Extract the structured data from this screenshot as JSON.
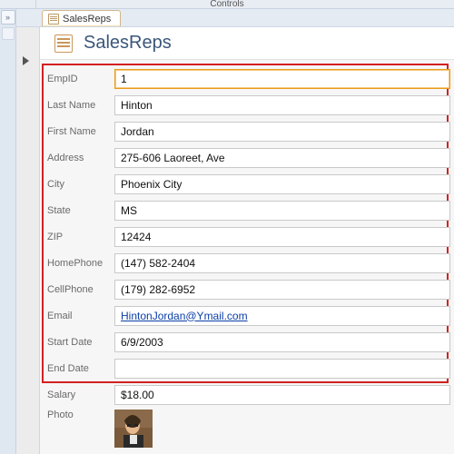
{
  "window": {
    "ribbon_title": "Controls"
  },
  "tab": {
    "label": "SalesReps"
  },
  "form": {
    "title": "SalesReps"
  },
  "fields": {
    "empid": {
      "label": "EmpID",
      "value": "1"
    },
    "lastname": {
      "label": "Last Name",
      "value": "Hinton"
    },
    "firstname": {
      "label": "First Name",
      "value": "Jordan"
    },
    "address": {
      "label": "Address",
      "value": "275-606 Laoreet, Ave"
    },
    "city": {
      "label": "City",
      "value": "Phoenix City"
    },
    "state": {
      "label": "State",
      "value": "MS"
    },
    "zip": {
      "label": "ZIP",
      "value": "12424"
    },
    "homephone": {
      "label": "HomePhone",
      "value": "(147) 582-2404"
    },
    "cellphone": {
      "label": "CellPhone",
      "value": "(179) 282-6952"
    },
    "email": {
      "label": "Email",
      "value": "HintonJordan@Ymail.com"
    },
    "startdate": {
      "label": "Start Date",
      "value": "6/9/2003"
    },
    "enddate": {
      "label": "End Date",
      "value": ""
    },
    "salary": {
      "label": "Salary",
      "value": "$18.00"
    },
    "photo": {
      "label": "Photo"
    }
  }
}
